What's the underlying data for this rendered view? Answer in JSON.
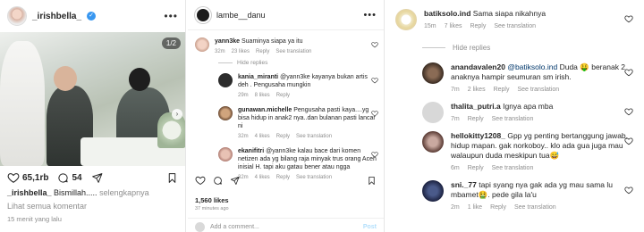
{
  "post": {
    "username": "_irishbella_",
    "counter": "1/2",
    "likes": "65,1rb",
    "comments": "54",
    "caption_user": "_irishbella_",
    "caption_text": "Bismillah.....",
    "caption_more": "selengkapnya",
    "view_all": "Lihat semua komentar",
    "time": "15 menit yang lalu"
  },
  "thread": {
    "username": "lambe__danu",
    "comments": [
      {
        "user": "yann3ke",
        "text": "Suaminya siapa ya itu",
        "time": "32m",
        "likes": "23 likes",
        "reply": "Reply",
        "translate": "See translation"
      },
      {
        "user": "kania_miranti",
        "text": "@yann3ke kayanya bukan artis deh . Pengusaha mungkin",
        "time": "29m",
        "likes": "8 likes",
        "reply": "Reply"
      },
      {
        "user": "gunawan.michelle",
        "text": "Pengusaha pasti kaya....yg bisa hidup in anak2 nya..dan bulanan pasti lancar ni",
        "time": "32m",
        "likes": "4 likes",
        "reply": "Reply",
        "translate": "See translation"
      },
      {
        "user": "ekanifitri",
        "text": "@yann3ke kalau bace dari komen netizen ada yg bilang raja minyak trus orang Aceh inisial H. tapi aku gatau bener atau ngga",
        "time": "32m",
        "likes": "4 likes",
        "reply": "Reply",
        "translate": "See translation"
      }
    ],
    "hide_replies": "Hide replies",
    "likes_count": "1,560 likes",
    "time_ago": "37 minutes ago",
    "add_comment": "Add a comment...",
    "post_label": "Post"
  },
  "replies": {
    "top": {
      "user": "batiksolo.ind",
      "text": "Sama siapa nikahnya",
      "time": "15m",
      "likes": "7 likes",
      "reply": "Reply",
      "translate": "See translation"
    },
    "hide_replies": "Hide replies",
    "items": [
      {
        "user": "anandavalen20",
        "mention": "@batiksolo.ind",
        "text": "Duda 🤑 beranak 2 anaknya hampir seumuran sm irish.",
        "time": "7m",
        "likes": "2 likes",
        "reply": "Reply",
        "translate": "See translation"
      },
      {
        "user": "thalita_putri.a",
        "text": "Ignya apa mba",
        "time": "7m",
        "likes": "",
        "reply": "Reply",
        "translate": "See translation"
      },
      {
        "user": "hellokitty1208_",
        "text": "Gpp yg penting bertanggung jawab, hidup mapan. gak norkoboy.. klo ada gua juga mau walaupun duda meskipun tua😅",
        "time": "6m",
        "likes": "",
        "reply": "Reply",
        "translate": "See translation"
      },
      {
        "user": "sni._77",
        "text": "tapi syang nya gak ada yg mau sama lu mbamet🤮. pede gila la'u",
        "time": "2m",
        "likes": "1 like",
        "reply": "Reply",
        "translate": "See translation"
      }
    ]
  },
  "colors": {
    "verified": "#3897f0",
    "link": "#00376b",
    "muted": "#8e8e8e",
    "heart": "#262626"
  }
}
